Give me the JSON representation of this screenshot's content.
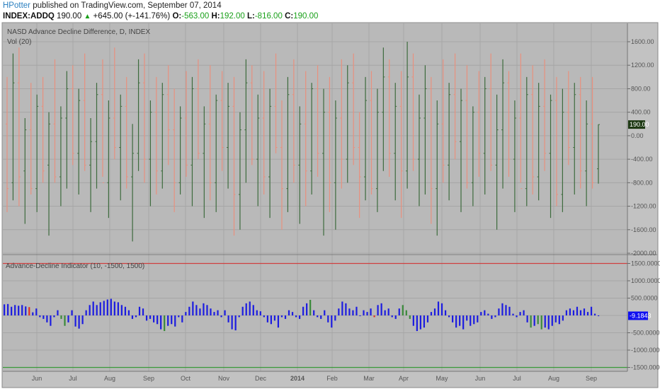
{
  "header": {
    "user": "HPotter",
    "published": "published on TradingView.com, September 07, 2014",
    "symbol": "INDEX:ADDQ",
    "last": "190.00",
    "change": "+645.00 (+-141.76%)",
    "o_label": "O:",
    "o": "-563.00",
    "h_label": "H:",
    "h": "192.00",
    "l_label": "L:",
    "l": "-816.00",
    "c_label": "C:",
    "c": "190.00",
    "up_icon": "triangle-up-icon"
  },
  "colors": {
    "background": "#b9b9b9",
    "grid": "#a6a6a6",
    "up_bar": "#3d6b3d",
    "down_bar": "#e8907e",
    "indicator": "#1c1ce0",
    "indicator_down": "#3a8a3a",
    "indicator_up": "#e03020",
    "upper_band": "#d04040",
    "lower_band": "#3a9a3a",
    "last_price_bg": "#1e3a14",
    "indicator_last_bg": "#1010f0"
  },
  "chart_data": [
    {
      "type": "ohlc",
      "title": "NASD Advance Decline Difference, D, INDEX",
      "subtitle": "Vol (20)",
      "ylim": [
        -2000,
        1800
      ],
      "yticks": [
        "1600.00",
        "1200.00",
        "800.00",
        "400.00",
        "0.00",
        "-400.00",
        "-800.00",
        "-1200.00",
        "-1600.00",
        "-2000.00"
      ],
      "ytick_values": [
        1600,
        1200,
        800,
        400,
        0,
        -400,
        -800,
        -1200,
        -1600,
        -2000
      ],
      "last_value_label": "190.00",
      "last_value": 190,
      "bars": [
        [
          200,
          1000,
          -1300,
          -900
        ],
        [
          -800,
          1400,
          -1100,
          900
        ],
        [
          900,
          1500,
          -1200,
          -700
        ],
        [
          -600,
          300,
          -1500,
          100
        ],
        [
          100,
          900,
          -1000,
          -900
        ],
        [
          -900,
          700,
          -1300,
          500
        ],
        [
          500,
          1000,
          -800,
          -600
        ],
        [
          -500,
          400,
          -1700,
          200
        ],
        [
          200,
          1300,
          -800,
          -700
        ],
        [
          -700,
          500,
          -1200,
          300
        ],
        [
          300,
          1100,
          -900,
          800
        ],
        [
          800,
          1200,
          -500,
          -300
        ],
        [
          -300,
          800,
          -1000,
          600
        ],
        [
          600,
          1400,
          -600,
          -500
        ],
        [
          -500,
          300,
          -1300,
          -100
        ],
        [
          -100,
          900,
          -900,
          700
        ],
        [
          700,
          1300,
          -700,
          -800
        ],
        [
          -800,
          600,
          -1400,
          300
        ],
        [
          300,
          1500,
          -400,
          -200
        ],
        [
          -200,
          700,
          -1100,
          500
        ],
        [
          500,
          1000,
          -900,
          -700
        ],
        [
          -700,
          200,
          -1800,
          -300
        ],
        [
          -300,
          1300,
          -600,
          900
        ],
        [
          900,
          1400,
          -800,
          -400
        ],
        [
          -400,
          600,
          -1200,
          400
        ],
        [
          400,
          1000,
          -1000,
          -600
        ],
        [
          -600,
          900,
          -900,
          700
        ],
        [
          700,
          1200,
          -500,
          100
        ],
        [
          100,
          800,
          -1300,
          -800
        ],
        [
          -800,
          500,
          -1000,
          300
        ],
        [
          300,
          1100,
          -700,
          -500
        ],
        [
          -500,
          1000,
          -1200,
          800
        ],
        [
          800,
          1300,
          -400,
          -300
        ],
        [
          -300,
          500,
          -1400,
          200
        ],
        [
          200,
          1200,
          -1100,
          -800
        ],
        [
          -800,
          700,
          -1300,
          600
        ],
        [
          600,
          1100,
          -600,
          -200
        ],
        [
          -200,
          900,
          -900,
          500
        ],
        [
          500,
          1000,
          -1700,
          -1000
        ],
        [
          -1000,
          400,
          -1600,
          100
        ],
        [
          100,
          1300,
          -800,
          900
        ],
        [
          900,
          1200,
          -500,
          -400
        ],
        [
          -400,
          700,
          -1200,
          300
        ],
        [
          300,
          1100,
          -1000,
          -700
        ],
        [
          -700,
          800,
          -1400,
          500
        ],
        [
          500,
          1400,
          -300,
          -200
        ],
        [
          -200,
          600,
          -1600,
          -900
        ],
        [
          -900,
          1000,
          -1300,
          700
        ],
        [
          700,
          1300,
          -800,
          -500
        ],
        [
          -500,
          500,
          -1500,
          200
        ],
        [
          200,
          1100,
          -1200,
          -600
        ],
        [
          -600,
          900,
          -1000,
          800
        ],
        [
          800,
          1200,
          -700,
          -300
        ],
        [
          -300,
          800,
          -1700,
          400
        ],
        [
          400,
          1000,
          -1300,
          -800
        ],
        [
          -800,
          600,
          -1600,
          300
        ],
        [
          300,
          1300,
          -900,
          -400
        ],
        [
          -400,
          1200,
          -800,
          900
        ],
        [
          900,
          1400,
          -500,
          -200
        ],
        [
          -200,
          400,
          -1400,
          -700
        ],
        [
          -700,
          1000,
          -1100,
          600
        ],
        [
          600,
          1100,
          -1000,
          -900
        ],
        [
          -900,
          800,
          -1300,
          400
        ],
        [
          400,
          1500,
          -600,
          1000
        ],
        [
          1000,
          1300,
          -700,
          -300
        ],
        [
          -300,
          900,
          -1100,
          500
        ],
        [
          500,
          1100,
          -1400,
          -600
        ],
        [
          -600,
          1600,
          -900,
          1000
        ],
        [
          1000,
          1400,
          -600,
          -400
        ],
        [
          -400,
          700,
          -1200,
          300
        ],
        [
          300,
          1200,
          -1000,
          800
        ],
        [
          800,
          1000,
          -1500,
          -900
        ],
        [
          -900,
          600,
          -1700,
          200
        ],
        [
          200,
          1300,
          -800,
          -500
        ],
        [
          -500,
          900,
          -1100,
          700
        ],
        [
          700,
          1400,
          -400,
          -100
        ],
        [
          -100,
          800,
          -1300,
          600
        ],
        [
          600,
          1200,
          -900,
          -800
        ],
        [
          -800,
          500,
          -1200,
          400
        ],
        [
          400,
          1100,
          -700,
          -300
        ],
        [
          -300,
          1000,
          -1000,
          800
        ],
        [
          800,
          1400,
          -600,
          -500
        ],
        [
          -500,
          700,
          -1600,
          100
        ],
        [
          100,
          1300,
          -900,
          900
        ],
        [
          900,
          1100,
          -700,
          -400
        ],
        [
          -400,
          600,
          -1300,
          300
        ],
        [
          300,
          1400,
          -800,
          -900
        ],
        [
          -900,
          1000,
          -1200,
          700
        ],
        [
          700,
          1200,
          -1000,
          -700
        ],
        [
          -700,
          900,
          -1100,
          500
        ],
        [
          500,
          1300,
          -600,
          -300
        ],
        [
          -300,
          700,
          -1400,
          600
        ],
        [
          600,
          1000,
          -1200,
          -1000
        ],
        [
          -1000,
          800,
          -1300,
          400
        ],
        [
          400,
          1100,
          -500,
          -200
        ],
        [
          -200,
          900,
          -1000,
          700
        ],
        [
          700,
          1000,
          -900,
          -600
        ],
        [
          -600,
          600,
          -1200,
          200
        ],
        [
          200,
          1000,
          -900,
          -800
        ],
        [
          -563,
          192,
          -816,
          190
        ]
      ]
    },
    {
      "type": "bar",
      "title": "Advance-Decline Indicator (10, -1500, 1500)",
      "ylim": [
        -1800,
        1800
      ],
      "yticks": [
        "1500.0000",
        "1000.0000",
        "500.0000",
        "-500.0000",
        "-1000.0000",
        "-1500.0000"
      ],
      "ytick_values": [
        1500,
        1000,
        500,
        -500,
        -1000,
        -1500
      ],
      "upper_band": 1500,
      "lower_band": -1500,
      "last_value_label": "-9.1843",
      "last_value": -9.18,
      "values": [
        320,
        330,
        250,
        300,
        280,
        300,
        260,
        240,
        90,
        200,
        -50,
        -100,
        -200,
        -300,
        -50,
        150,
        -100,
        -300,
        -200,
        150,
        -320,
        -380,
        -250,
        150,
        300,
        400,
        300,
        380,
        420,
        460,
        480,
        400,
        380,
        300,
        250,
        150,
        -100,
        -50,
        250,
        200,
        -150,
        -100,
        -200,
        -250,
        -400,
        -450,
        -300,
        -250,
        -320,
        -50,
        -200,
        100,
        250,
        400,
        300,
        200,
        350,
        300,
        200,
        100,
        150,
        -50,
        150,
        -200,
        -400,
        -430,
        -50,
        250,
        350,
        400,
        300,
        150,
        120,
        -50,
        -200,
        -250,
        -150,
        -350,
        -50,
        -100,
        150,
        100,
        -50,
        -100,
        250,
        350,
        450,
        150,
        -50,
        -100,
        150,
        -200,
        -350,
        -150,
        200,
        400,
        350,
        200,
        150,
        250,
        -20,
        150,
        100,
        200,
        -50,
        300,
        350,
        150,
        200,
        -50,
        -100,
        200,
        300,
        150,
        -100,
        -300,
        -450,
        -400,
        -350,
        -200,
        100,
        200,
        400,
        350,
        150,
        -50,
        -200,
        -350,
        -300,
        -400,
        -150,
        -300,
        -250,
        -200,
        100,
        150,
        50,
        -100,
        -50,
        200,
        350,
        300,
        250,
        50,
        -50,
        100,
        150,
        -200,
        -350,
        -300,
        -250,
        -400,
        -350,
        -400,
        -300,
        -200,
        -250,
        -150,
        150,
        200,
        150,
        250,
        150,
        200,
        100,
        250,
        50,
        -9
      ],
      "down_color_indices": [
        16,
        17,
        45,
        86,
        112,
        113,
        114,
        148,
        150,
        151
      ],
      "up_color_indices": [
        7,
        104
      ]
    }
  ],
  "time_axis": [
    "Jun",
    "Jul",
    "Aug",
    "Sep",
    "Oct",
    "Nov",
    "Dec",
    "2014",
    "Feb",
    "Mar",
    "Apr",
    "May",
    "Jun",
    "Jul",
    "Aug",
    "Sep"
  ]
}
